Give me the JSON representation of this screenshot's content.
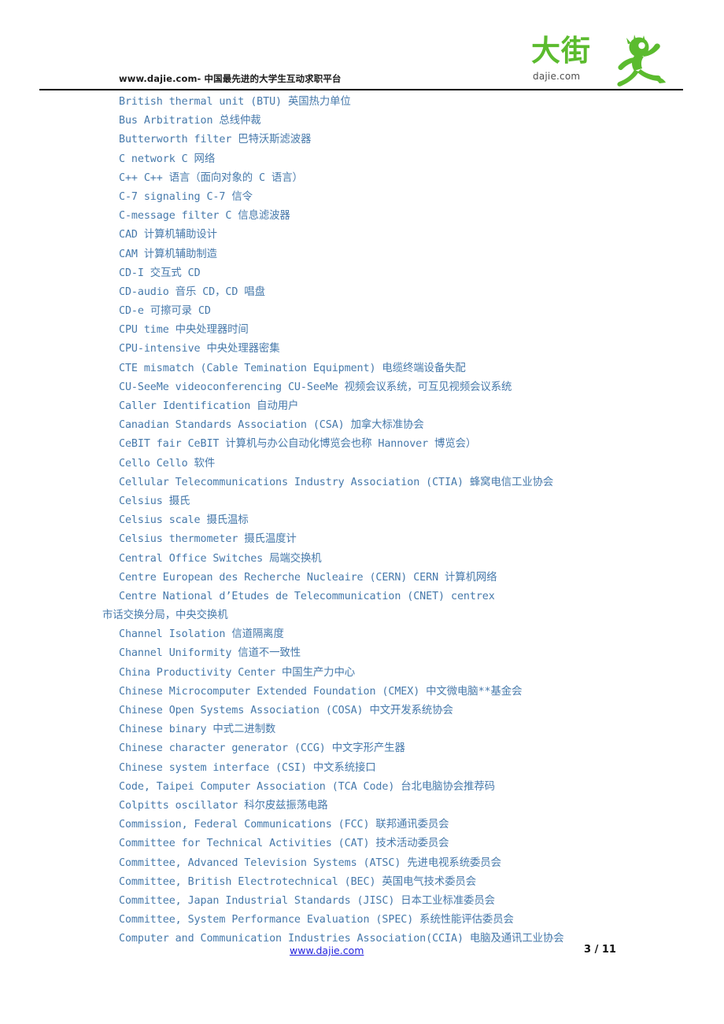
{
  "header": {
    "tagline": "www.dajie.com- 中国最先进的大学生互动求职平台",
    "logo": {
      "wordmark": "大街",
      "domain": "dajie.com",
      "icon": "running-person-icon",
      "color": "#5bbb2e"
    },
    "rule_color": "#000000"
  },
  "body": {
    "text_color": "#4679ab",
    "lines": [
      {
        "text": "British thermal unit (BTU)  英国热力单位",
        "continuation": false
      },
      {
        "text": "Bus Arbitration  总线仲裁",
        "continuation": false
      },
      {
        "text": "Butterworth filter  巴特沃斯滤波器",
        "continuation": false
      },
      {
        "text": "C network  C 网络",
        "continuation": false
      },
      {
        "text": "C++ C++  语言（面向对象的 C 语言）",
        "continuation": false
      },
      {
        "text": "C-7 signaling C-7  信令",
        "continuation": false
      },
      {
        "text": "C-message filter  C 信息滤波器",
        "continuation": false
      },
      {
        "text": "CAD  计算机辅助设计",
        "continuation": false
      },
      {
        "text": "CAM  计算机辅助制造",
        "continuation": false
      },
      {
        "text": "CD-I  交互式 CD",
        "continuation": false
      },
      {
        "text": "CD-audio  音乐 CD，CD 唱盘",
        "continuation": false
      },
      {
        "text": "CD-e  可擦可录 CD",
        "continuation": false
      },
      {
        "text": "CPU time  中央处理器时间",
        "continuation": false
      },
      {
        "text": "CPU-intensive  中央处理器密集",
        "continuation": false
      },
      {
        "text": "CTE mismatch (Cable Temination Equipment)  电缆终端设备失配",
        "continuation": false
      },
      {
        "text": "CU-SeeMe videoconferencing CU-SeeMe  视频会议系统，可互见视频会议系统",
        "continuation": false
      },
      {
        "text": "Caller Identification  自动用户",
        "continuation": false
      },
      {
        "text": "Canadian Standards Association (CSA)  加拿大标准协会",
        "continuation": false
      },
      {
        "text": "CeBIT fair CeBIT  计算机与办公自动化博览会也称 Hannover 博览会）",
        "continuation": false
      },
      {
        "text": "Cello Cello  软件",
        "continuation": false
      },
      {
        "text": "Cellular Telecommunications Industry Association (CTIA)  蜂窝电信工业协会",
        "continuation": false
      },
      {
        "text": "Celsius  摄氏",
        "continuation": false
      },
      {
        "text": "Celsius scale  摄氏温标",
        "continuation": false
      },
      {
        "text": "Celsius thermometer  摄氏温度计",
        "continuation": false
      },
      {
        "text": "Central Office Switches  局端交换机",
        "continuation": false
      },
      {
        "text": "Centre European des Recherche Nucleaire (CERN) CERN  计算机网络",
        "continuation": false
      },
      {
        "text": "Centre National d’Etudes de Telecommunication (CNET) centrex",
        "continuation": false
      },
      {
        "text": "市话交换分局，中央交换机",
        "continuation": true
      },
      {
        "text": "Channel Isolation  信道隔离度",
        "continuation": false
      },
      {
        "text": "Channel Uniformity  信道不一致性",
        "continuation": false
      },
      {
        "text": "China Productivity Center  中国生产力中心",
        "continuation": false
      },
      {
        "text": "Chinese Microcomputer Extended Foundation (CMEX)  中文微电脑**基金会",
        "continuation": false
      },
      {
        "text": "Chinese Open Systems Association (COSA)  中文开发系统协会",
        "continuation": false
      },
      {
        "text": "Chinese binary  中式二进制数",
        "continuation": false
      },
      {
        "text": "Chinese character generator (CCG)  中文字形产生器",
        "continuation": false
      },
      {
        "text": "Chinese system interface (CSI)  中文系统接口",
        "continuation": false
      },
      {
        "text": "Code, Taipei Computer Association (TCA Code)  台北电脑协会推荐码",
        "continuation": false
      },
      {
        "text": "Colpitts oscillator  科尔皮兹振荡电路",
        "continuation": false
      },
      {
        "text": "Commission, Federal Communications (FCC)  联邦通讯委员会",
        "continuation": false
      },
      {
        "text": "Committee for Technical Activities (CAT)  技术活动委员会",
        "continuation": false
      },
      {
        "text": "Committee, Advanced Television Systems (ATSC)  先进电视系统委员会",
        "continuation": false
      },
      {
        "text": "Committee, British Electrotechnical (BEC)  英国电气技术委员会",
        "continuation": false
      },
      {
        "text": "Committee, Japan Industrial Standards (JISC)  日本工业标准委员会",
        "continuation": false
      },
      {
        "text": "Committee, System Performance Evaluation (SPEC)  系统性能评估委员会",
        "continuation": false
      },
      {
        "text": "Computer and Communication Industries Association(CCIA)  电脑及通讯工业协会",
        "continuation": false
      }
    ]
  },
  "footer": {
    "link": "www.dajie.com",
    "link_color": "#2222dd",
    "page_number": "3 / 11"
  }
}
